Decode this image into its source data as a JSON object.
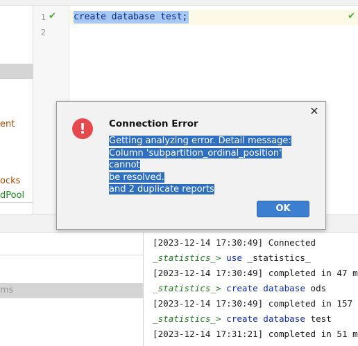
{
  "editor": {
    "line_numbers": [
      "1",
      "2"
    ],
    "code_line": "create database test;",
    "status_icon": "check-icon"
  },
  "left_panel": {
    "items": [
      "ent",
      "ocks",
      "dPool"
    ]
  },
  "bottom_left": {
    "label": "ms"
  },
  "console": {
    "lines": [
      {
        "type": "log",
        "text": "[2023-12-14 17:30:49] Connected"
      },
      {
        "type": "cmd",
        "prompt": "_statistics_>",
        "keyword": "use",
        "rest": "_statistics_"
      },
      {
        "type": "log",
        "text": "[2023-12-14 17:30:49] completed in 47 m"
      },
      {
        "type": "cmd",
        "prompt": "_statistics_>",
        "keyword": "create database",
        "rest": "ods"
      },
      {
        "type": "log",
        "text": "[2023-12-14 17:30:49] completed in 157"
      },
      {
        "type": "cmd",
        "prompt": "_statistics_>",
        "keyword": "create database",
        "rest": "test"
      },
      {
        "type": "log",
        "text": "[2023-12-14 17:31:21] completed in 51 m"
      }
    ]
  },
  "dialog": {
    "title": "Connection Error",
    "icon": "error-icon",
    "message_lines": [
      "Getting analyzing error. Detail message:",
      "Column 'subpartition_ordinal_position' cannot",
      "be resolved.",
      "and 2 duplicate reports"
    ],
    "ok_label": "OK",
    "close_icon": "close-icon"
  },
  "colors": {
    "error": "#e5484d",
    "ok_button": "#3c7fd0",
    "selection": "#2f6fc1",
    "prompt": "#1f7a1f",
    "keyword": "#0b2bb5",
    "check": "#4da83a"
  }
}
